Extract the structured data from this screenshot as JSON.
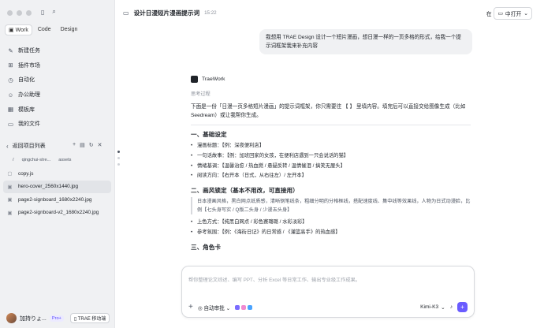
{
  "sidebar": {
    "tabs": [
      {
        "label": "Work"
      },
      {
        "label": "Code"
      },
      {
        "label": "Design"
      }
    ],
    "nav": [
      {
        "label": "新建任务",
        "icon": "edit-icon"
      },
      {
        "label": "插件市场",
        "icon": "grid-icon"
      },
      {
        "label": "自动化",
        "icon": "clock-icon"
      },
      {
        "label": "办公助理",
        "icon": "robot-icon"
      },
      {
        "label": "模板库",
        "icon": "template-icon"
      },
      {
        "label": "我的文件",
        "icon": "folder-icon"
      }
    ],
    "project_back": "返回项目列表",
    "crumbs": [
      "/",
      "qingchui-stre...",
      "assets"
    ],
    "files": [
      {
        "name": "copy.js"
      },
      {
        "name": "hero-cover_2560x1440.jpg"
      },
      {
        "name": "page2-signboard_1680x2240.jpg"
      },
      {
        "name": "page2-signboard-v2_1680x2240.jpg"
      }
    ],
    "user": {
      "name": "加持りょ...",
      "badge": "Pro+",
      "mobile": "TRAE 移动端"
    }
  },
  "header": {
    "title": "设计日漫短片漫画提示词",
    "time": "15:22",
    "in": "在",
    "open": "中打开"
  },
  "user_message": "我想用 TRAE Design 设计一个短片漫画，想日漫一样的一页多格的形式，给我一个提示词框架我来补充内容",
  "bot": {
    "name": "TraeWork",
    "thinking": "思考过程",
    "intro": "下面是一份「日漫一页多格短片漫画」的提示词框架，你只需要往 【 】 里填内容。填完后可以直接交给图像生成（比如 Seedream）或让我帮你生成。",
    "s1_title": "一、基础设定",
    "s1": [
      "漫画标题：【例：深夜便利店】",
      "一句话故事：【例：加班回家的女孩，在便利店遇到一只会说话的猫】",
      "情绪基调：【温馨治愈 / 热血燃 / 悬疑反转 / 温情催泪 / 搞笑无厘头】",
      "阅读方向：【右开本（日式，从右往左）/ 左开本】"
    ],
    "s2_title": "二、画风锁定（基本不用改，可直接用）",
    "s2_quote": "日本漫画风格，黑白网点纸质感，清晰钢笔线条，粗细分明的分格框线，搭配速度线、集中线等效果线，人物为日式动漫脸，比例【七头身写实 / Q版二头身 / 少漫五头身】",
    "s2": [
      "上色方式：【纯黑白网点 / 彩色赛璐璐 / 水彩淡彩】",
      "参考氛围：【例：《海街日记》的日常感 / 《灌篮高手》的热血感】"
    ],
    "s3_title": "三、角色卡"
  },
  "composer": {
    "placeholder": "帮你整理论文综述、编写 PPT、分析 Excel 等日常工作、输出专业级工作成果。",
    "auto": "自动审批",
    "model": "Kimi-K3"
  }
}
